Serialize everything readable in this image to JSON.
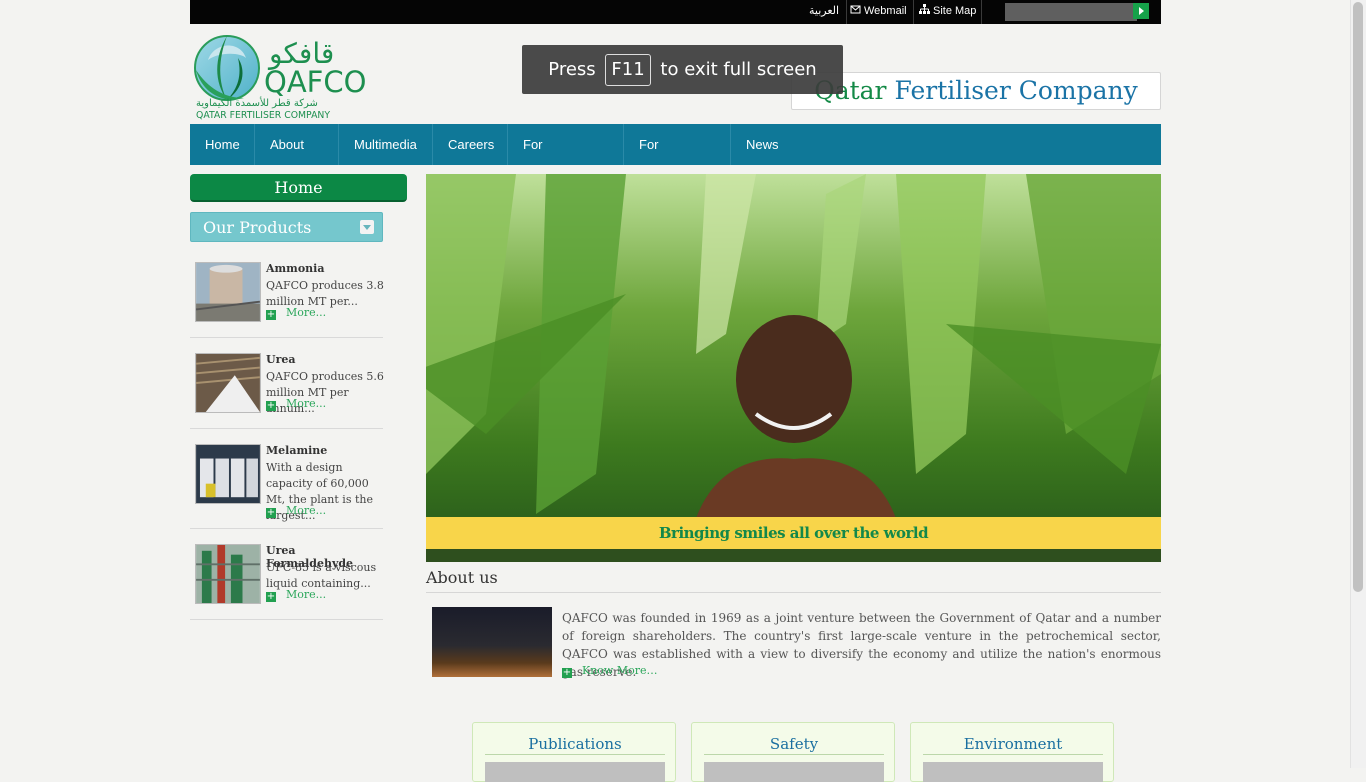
{
  "topbar": {
    "arabic": "العربية",
    "webmail": "Webmail",
    "sitemap": "Site Map",
    "search_placeholder": ""
  },
  "logo": {
    "arabic_wordmark": "قافكو",
    "latin_wordmark": "QAFCO",
    "arabic_name": "شركة قطر للأسمدة الكيماوية",
    "latin_name": "QATAR FERTILISER COMPANY"
  },
  "company_title": {
    "part1": "Qatar",
    "part2": "Fertiliser Company"
  },
  "fullscreen_notice": {
    "press": "Press",
    "key": "F11",
    "rest": "to exit full screen"
  },
  "nav": [
    {
      "label": "Home"
    },
    {
      "label": "About Us"
    },
    {
      "label": "Multimedia"
    },
    {
      "label": "Careers"
    },
    {
      "label": "For Customers"
    },
    {
      "label": "For Suppliers"
    },
    {
      "label": "News Room"
    }
  ],
  "sidebar": {
    "home_label": "Home",
    "products_label": "Our Products",
    "products": [
      {
        "title": "Ammonia",
        "desc": "QAFCO produces 3.8 million MT per...",
        "more": "More..."
      },
      {
        "title": "Urea",
        "desc": "QAFCO produces 5.6 million MT per annum...",
        "more": "More..."
      },
      {
        "title": "Melamine",
        "desc": "With a design capacity of 60,000 Mt, the plant is the largest...",
        "more": "More..."
      },
      {
        "title": "Urea Formaldehyde",
        "desc": "UFC-85 is a viscous liquid containing...",
        "more": "More..."
      }
    ]
  },
  "hero": {
    "caption": "Bringing smiles all over the world"
  },
  "about": {
    "heading": "About us",
    "text": "QAFCO was founded in 1969 as a joint venture between the Government of Qatar and a number of foreign shareholders. The country's first large-scale venture in the petrochemical sector, QAFCO was established with a view to diversify the economy and utilize the nation's enormous gas reserve.",
    "more": "Know More…"
  },
  "boxes": [
    {
      "title": "Publications"
    },
    {
      "title": "Safety"
    },
    {
      "title": "Environment"
    }
  ],
  "colors": {
    "nav": "#0f7898",
    "home_button": "#0c8845",
    "products_header": "#75c7cd",
    "caption_bg": "#f8d54a",
    "caption_text": "#13884a",
    "link_green": "#2aa65a"
  }
}
